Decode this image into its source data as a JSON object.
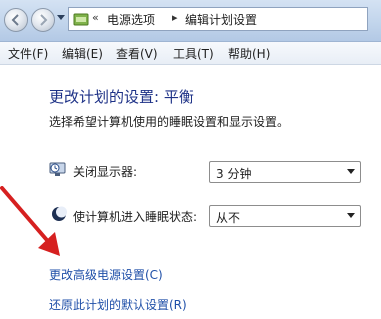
{
  "nav": {
    "breadcrumb_prefix": "«",
    "crumbs": [
      "电源选项",
      "编辑计划设置"
    ],
    "separator": "▸"
  },
  "menu": {
    "items": [
      "文件(F)",
      "编辑(E)",
      "查看(V)",
      "工具(T)",
      "帮助(H)"
    ]
  },
  "main": {
    "title": "更改计划的设置: 平衡",
    "description": "选择希望计算机使用的睡眠设置和显示设置。",
    "settings": [
      {
        "label": "关闭显示器:",
        "value": "3 分钟",
        "icon": "monitor-clock-icon"
      },
      {
        "label": "使计算机进入睡眠状态:",
        "value": "从不",
        "icon": "moon-sleep-icon"
      }
    ],
    "links": {
      "advanced": "更改高级电源设置(C)",
      "restore": "还原此计划的默认设置(R)"
    }
  },
  "colors": {
    "title": "#1e3287",
    "link": "#1f4fa8",
    "annotation_arrow": "#d62020"
  }
}
